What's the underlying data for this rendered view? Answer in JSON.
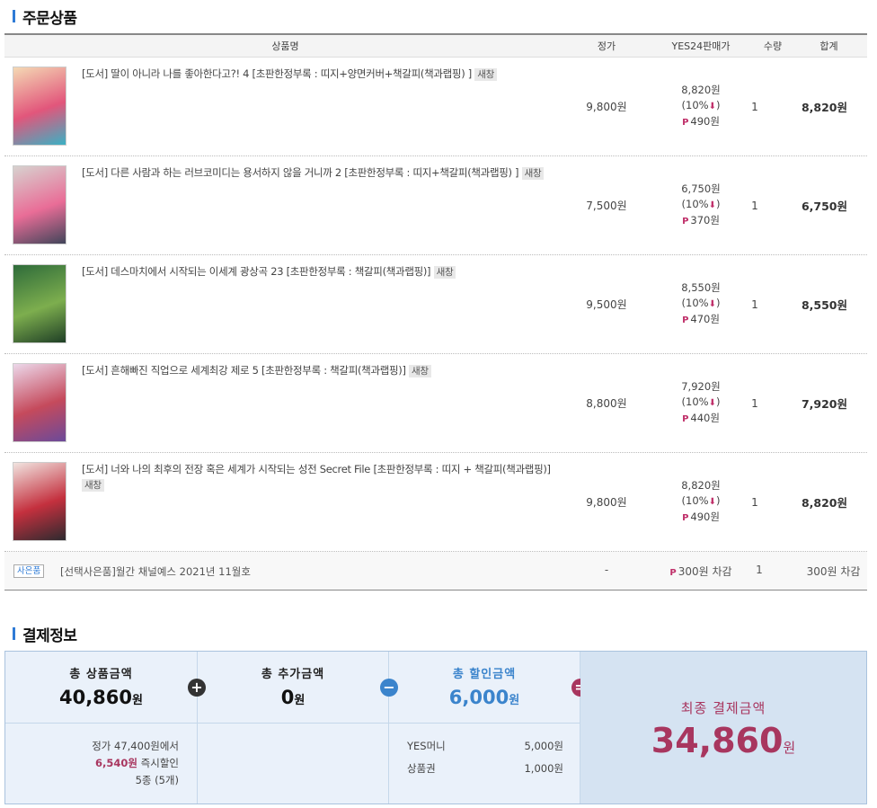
{
  "order_section": {
    "title": "주문상품"
  },
  "table": {
    "headers": {
      "name": "상품명",
      "price": "정가",
      "sale": "YES24판매가",
      "qty": "수량",
      "total": "합계"
    },
    "rows": [
      {
        "title": "[도서] 딸이 아니라 나를 좋아한다고?! 4 [초판한정부록 : 띠지+양면커버+책갈피(책과랩핑) ]",
        "badge": "새창",
        "price": "9,800원",
        "sale_price": "8,820원",
        "discount": "(10%",
        "points": "490원",
        "qty": "1",
        "total": "8,820원",
        "cover_colors": [
          "#f4d9b4",
          "#e2567b",
          "#3ab1c4"
        ]
      },
      {
        "title": "[도서] 다른 사람과 하는 러브코미디는 용서하지 않을 거니까 2 [초판한정부록 : 띠지+책갈피(책과랩핑) ]",
        "badge": "새창",
        "price": "7,500원",
        "sale_price": "6,750원",
        "discount": "(10%",
        "points": "370원",
        "qty": "1",
        "total": "6,750원",
        "cover_colors": [
          "#d7d2cf",
          "#e96d97",
          "#41455a"
        ]
      },
      {
        "title": "[도서] 데스마치에서 시작되는 이세계 광상곡 23 [초판한정부록 : 책갈피(책과랩핑)]",
        "badge": "새창",
        "price": "9,500원",
        "sale_price": "8,550원",
        "discount": "(10%",
        "points": "470원",
        "qty": "1",
        "total": "8,550원",
        "cover_colors": [
          "#2e6b3a",
          "#7dae4e",
          "#1f3f26"
        ]
      },
      {
        "title": "[도서] 흔해빠진 직업으로 세계최강 제로 5 [초판한정부록 : 책갈피(책과랩핑)]",
        "badge": "새창",
        "price": "8,800원",
        "sale_price": "7,920원",
        "discount": "(10%",
        "points": "440원",
        "qty": "1",
        "total": "7,920원",
        "cover_colors": [
          "#ecd8ea",
          "#c54a5c",
          "#6b4a9a"
        ]
      },
      {
        "title": "[도서] 너와 나의 최후의 전장 혹은 세계가 시작되는 성전 Secret File [초판한정부록 : 띠지 + 책갈피(책과랩핑)]",
        "badge": "새창",
        "price": "9,800원",
        "sale_price": "8,820원",
        "discount": "(10%",
        "points": "490원",
        "qty": "1",
        "total": "8,820원",
        "cover_colors": [
          "#f1e4e0",
          "#c4303e",
          "#2d2a2f"
        ]
      }
    ],
    "gift": {
      "icon_label": "사은품",
      "text": "[선택사은품]월간 채널예스 2021년 11월호",
      "dash": "-",
      "deduct": "300원 차감",
      "qty": "1",
      "total": "300원 차감"
    }
  },
  "payment_section": {
    "title": "결제정보",
    "product_total_label": "총 상품금액",
    "product_total": "40,860",
    "extra_label": "총 추가금액",
    "extra_total": "0",
    "discount_label": "총 할인금액",
    "discount_total": "6,000",
    "unit": "원",
    "final_label": "최종 결제금액",
    "final_total": "34,860",
    "detail_list_price": "정가 47,400원에서",
    "detail_instant": "6,540원",
    "detail_instant_suffix": "즉시할인",
    "detail_count": "5종 (5개)",
    "discount_items": [
      {
        "name": "YES머니",
        "amount": "5,000원"
      },
      {
        "name": "상품권",
        "amount": "1,000원"
      }
    ]
  },
  "colors": {
    "accent": "#2f7bd6",
    "final": "#a8365f",
    "discount_blue": "#3b84cc"
  }
}
